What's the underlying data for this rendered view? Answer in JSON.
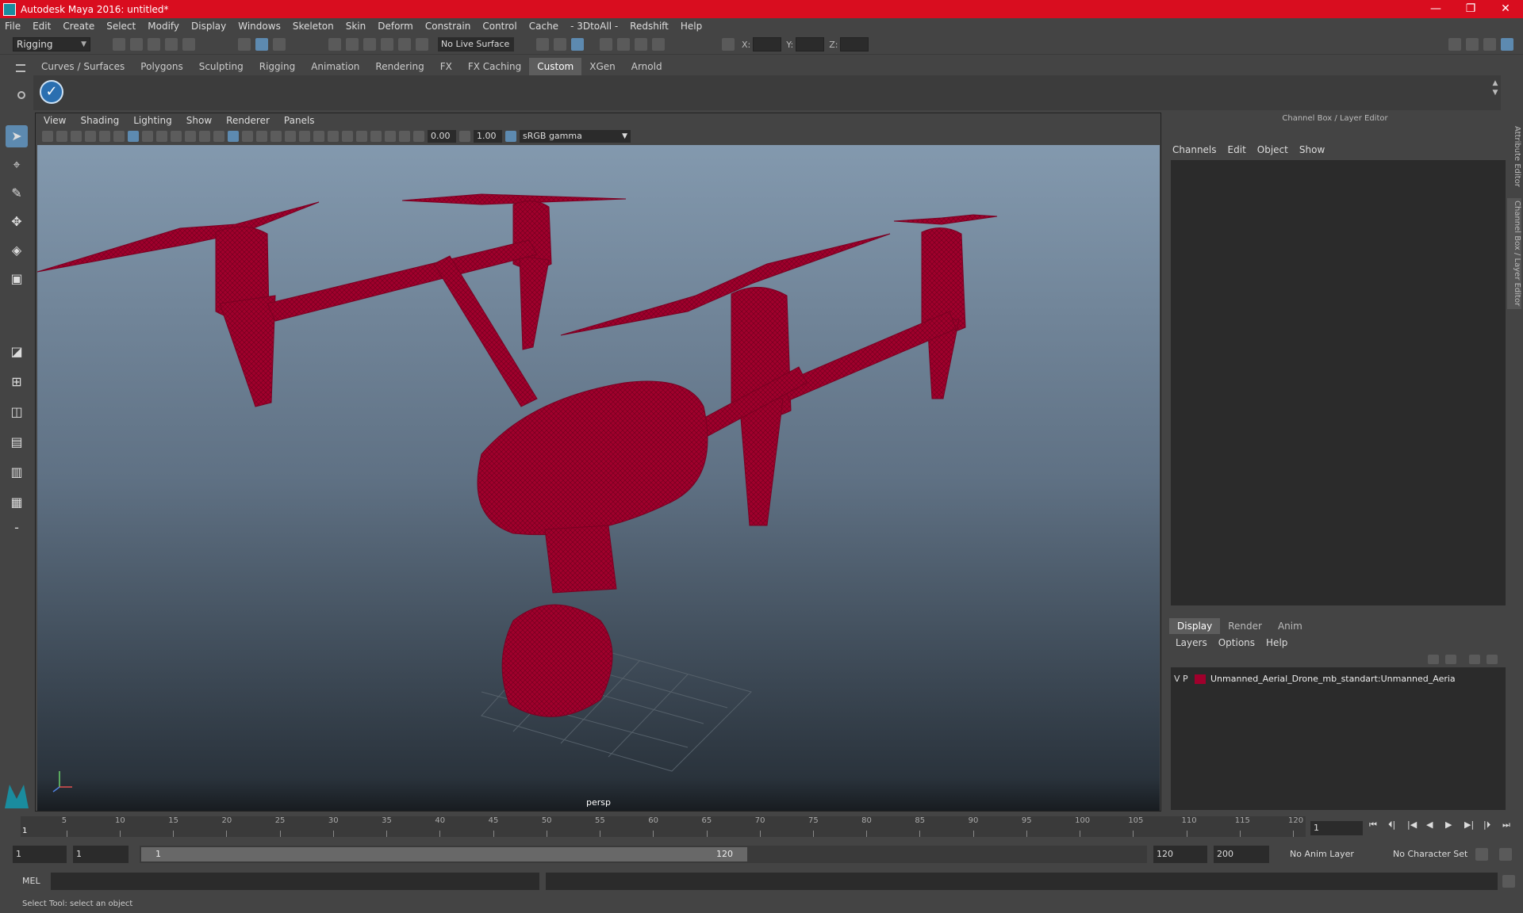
{
  "window": {
    "title": "Autodesk Maya 2016: untitled*",
    "controls": [
      "—",
      "❐",
      "✕"
    ]
  },
  "menubar": [
    "File",
    "Edit",
    "Create",
    "Select",
    "Modify",
    "Display",
    "Windows",
    "Skeleton",
    "Skin",
    "Deform",
    "Constrain",
    "Control",
    "Cache",
    "- 3DtoAll -",
    "Redshift",
    "Help"
  ],
  "statusline": {
    "mode": "Rigging",
    "live_surface": "No Live Surface",
    "x_label": "X:",
    "y_label": "Y:",
    "z_label": "Z:"
  },
  "shelf": {
    "tabs": [
      "Curves / Surfaces",
      "Polygons",
      "Sculpting",
      "Rigging",
      "Animation",
      "Rendering",
      "FX",
      "FX Caching",
      "Custom",
      "XGen",
      "Arnold"
    ],
    "active_tab": "Custom"
  },
  "viewport": {
    "menu": [
      "View",
      "Shading",
      "Lighting",
      "Show",
      "Renderer",
      "Panels"
    ],
    "exposure": "0.00",
    "gamma_value": "1.00",
    "color_space": "sRGB gamma",
    "camera": "persp",
    "wire_color": "#a0002c"
  },
  "channel_box": {
    "title": "Channel Box / Layer Editor",
    "menu": [
      "Channels",
      "Edit",
      "Object",
      "Show"
    ]
  },
  "layer_editor": {
    "tabs": [
      "Display",
      "Render",
      "Anim"
    ],
    "active_tab": "Display",
    "menu": [
      "Layers",
      "Options",
      "Help"
    ],
    "layers": [
      {
        "v": "V",
        "p": "P",
        "color": "#a0002c",
        "name": "Unmanned_Aerial_Drone_mb_standart:Unmanned_Aeria"
      }
    ]
  },
  "side_tabs": [
    "Attribute Editor",
    "Channel Box / Layer Editor"
  ],
  "timeslider": {
    "ticks": [
      5,
      10,
      15,
      20,
      25,
      30,
      35,
      40,
      45,
      50,
      55,
      60,
      65,
      70,
      75,
      80,
      85,
      90,
      95,
      100,
      105,
      110,
      115,
      120
    ],
    "start_label": "1",
    "current_frame": "1",
    "max": 120
  },
  "range": {
    "start": "1",
    "playback_start": "1",
    "range_start_label": "1",
    "range_end_label": "120",
    "playback_end": "120",
    "end": "200",
    "anim_layer": "No Anim Layer",
    "character_set": "No Character Set"
  },
  "cmdline": {
    "label": "MEL"
  },
  "helpline": {
    "text": "Select Tool: select an object"
  }
}
